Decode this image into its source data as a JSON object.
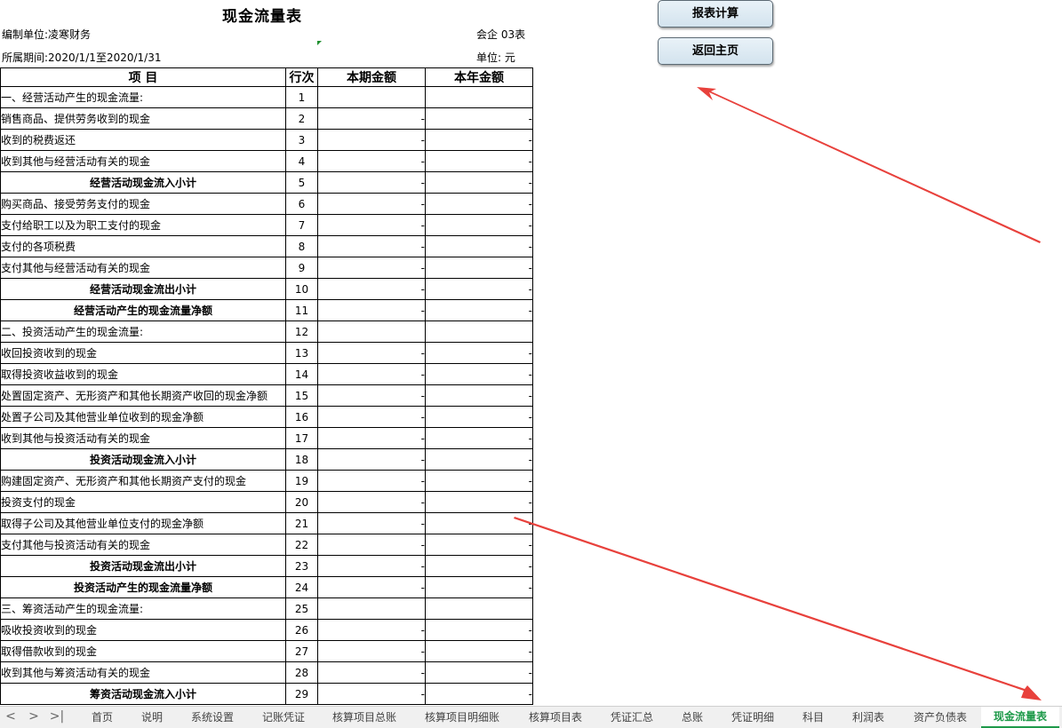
{
  "title": "现金流量表",
  "info": {
    "unit_name": "编制单位:凌寒财务",
    "period": "所属期间:2020/1/1至2020/1/31",
    "form_code": "会企 03表",
    "currency_unit": "单位:  元"
  },
  "buttons": {
    "calc": "报表计算",
    "home": "返回主页"
  },
  "table": {
    "headers": [
      "项 目",
      "行次",
      "本期金额",
      "本年金额"
    ],
    "rows": [
      {
        "item": "一、经营活动产生的现金流量:",
        "line": "1",
        "cur": "",
        "year": "",
        "sub": false
      },
      {
        "item": "销售商品、提供劳务收到的现金",
        "line": "2",
        "cur": "-",
        "year": "-",
        "sub": false
      },
      {
        "item": "收到的税费返还",
        "line": "3",
        "cur": "-",
        "year": "-",
        "sub": false
      },
      {
        "item": "收到其他与经营活动有关的现金",
        "line": "4",
        "cur": "-",
        "year": "-",
        "sub": false
      },
      {
        "item": "经营活动现金流入小计",
        "line": "5",
        "cur": "-",
        "year": "-",
        "sub": true
      },
      {
        "item": "购买商品、接受劳务支付的现金",
        "line": "6",
        "cur": "-",
        "year": "-",
        "sub": false
      },
      {
        "item": "支付给职工以及为职工支付的现金",
        "line": "7",
        "cur": "-",
        "year": "-",
        "sub": false
      },
      {
        "item": "支付的各项税费",
        "line": "8",
        "cur": "-",
        "year": "-",
        "sub": false
      },
      {
        "item": "支付其他与经营活动有关的现金",
        "line": "9",
        "cur": "-",
        "year": "-",
        "sub": false
      },
      {
        "item": "经营活动现金流出小计",
        "line": "10",
        "cur": "-",
        "year": "-",
        "sub": true
      },
      {
        "item": "经营活动产生的现金流量净额",
        "line": "11",
        "cur": "-",
        "year": "-",
        "sub": true
      },
      {
        "item": "二、投资活动产生的现金流量:",
        "line": "12",
        "cur": "",
        "year": "",
        "sub": false
      },
      {
        "item": "收回投资收到的现金",
        "line": "13",
        "cur": "-",
        "year": "-",
        "sub": false
      },
      {
        "item": "取得投资收益收到的现金",
        "line": "14",
        "cur": "-",
        "year": "-",
        "sub": false
      },
      {
        "item": "处置固定资产、无形资产和其他长期资产收回的现金净额",
        "line": "15",
        "cur": "-",
        "year": "-",
        "sub": false
      },
      {
        "item": "处置子公司及其他营业单位收到的现金净额",
        "line": "16",
        "cur": "-",
        "year": "-",
        "sub": false
      },
      {
        "item": "收到其他与投资活动有关的现金",
        "line": "17",
        "cur": "-",
        "year": "-",
        "sub": false
      },
      {
        "item": "投资活动现金流入小计",
        "line": "18",
        "cur": "-",
        "year": "-",
        "sub": true
      },
      {
        "item": "购建固定资产、无形资产和其他长期资产支付的现金",
        "line": "19",
        "cur": "-",
        "year": "-",
        "sub": false
      },
      {
        "item": "投资支付的现金",
        "line": "20",
        "cur": "-",
        "year": "-",
        "sub": false
      },
      {
        "item": "取得子公司及其他营业单位支付的现金净额",
        "line": "21",
        "cur": "-",
        "year": "-",
        "sub": false
      },
      {
        "item": "支付其他与投资活动有关的现金",
        "line": "22",
        "cur": "-",
        "year": "-",
        "sub": false
      },
      {
        "item": "投资活动现金流出小计",
        "line": "23",
        "cur": "-",
        "year": "-",
        "sub": true
      },
      {
        "item": "投资活动产生的现金流量净额",
        "line": "24",
        "cur": "-",
        "year": "-",
        "sub": true
      },
      {
        "item": "三、筹资活动产生的现金流量:",
        "line": "25",
        "cur": "",
        "year": "",
        "sub": false
      },
      {
        "item": "吸收投资收到的现金",
        "line": "26",
        "cur": "-",
        "year": "-",
        "sub": false
      },
      {
        "item": "取得借款收到的现金",
        "line": "27",
        "cur": "-",
        "year": "-",
        "sub": false
      },
      {
        "item": "收到其他与筹资活动有关的现金",
        "line": "28",
        "cur": "-",
        "year": "-",
        "sub": false
      },
      {
        "item": "筹资活动现金流入小计",
        "line": "29",
        "cur": "-",
        "year": "-",
        "sub": true
      }
    ]
  },
  "tabs": {
    "nav": [
      "<",
      ">",
      ">|"
    ],
    "items": [
      "首页",
      "说明",
      "系统设置",
      "记账凭证",
      "核算项目总账",
      "核算项目明细账",
      "核算项目表",
      "凭证汇总",
      "总账",
      "凭证明细",
      "科目",
      "利润表",
      "资产负债表",
      "现金流量表"
    ],
    "active": "现金流量表"
  },
  "colors": {
    "arrow": "#e8413c",
    "active_tab": "#1e9a4a"
  }
}
